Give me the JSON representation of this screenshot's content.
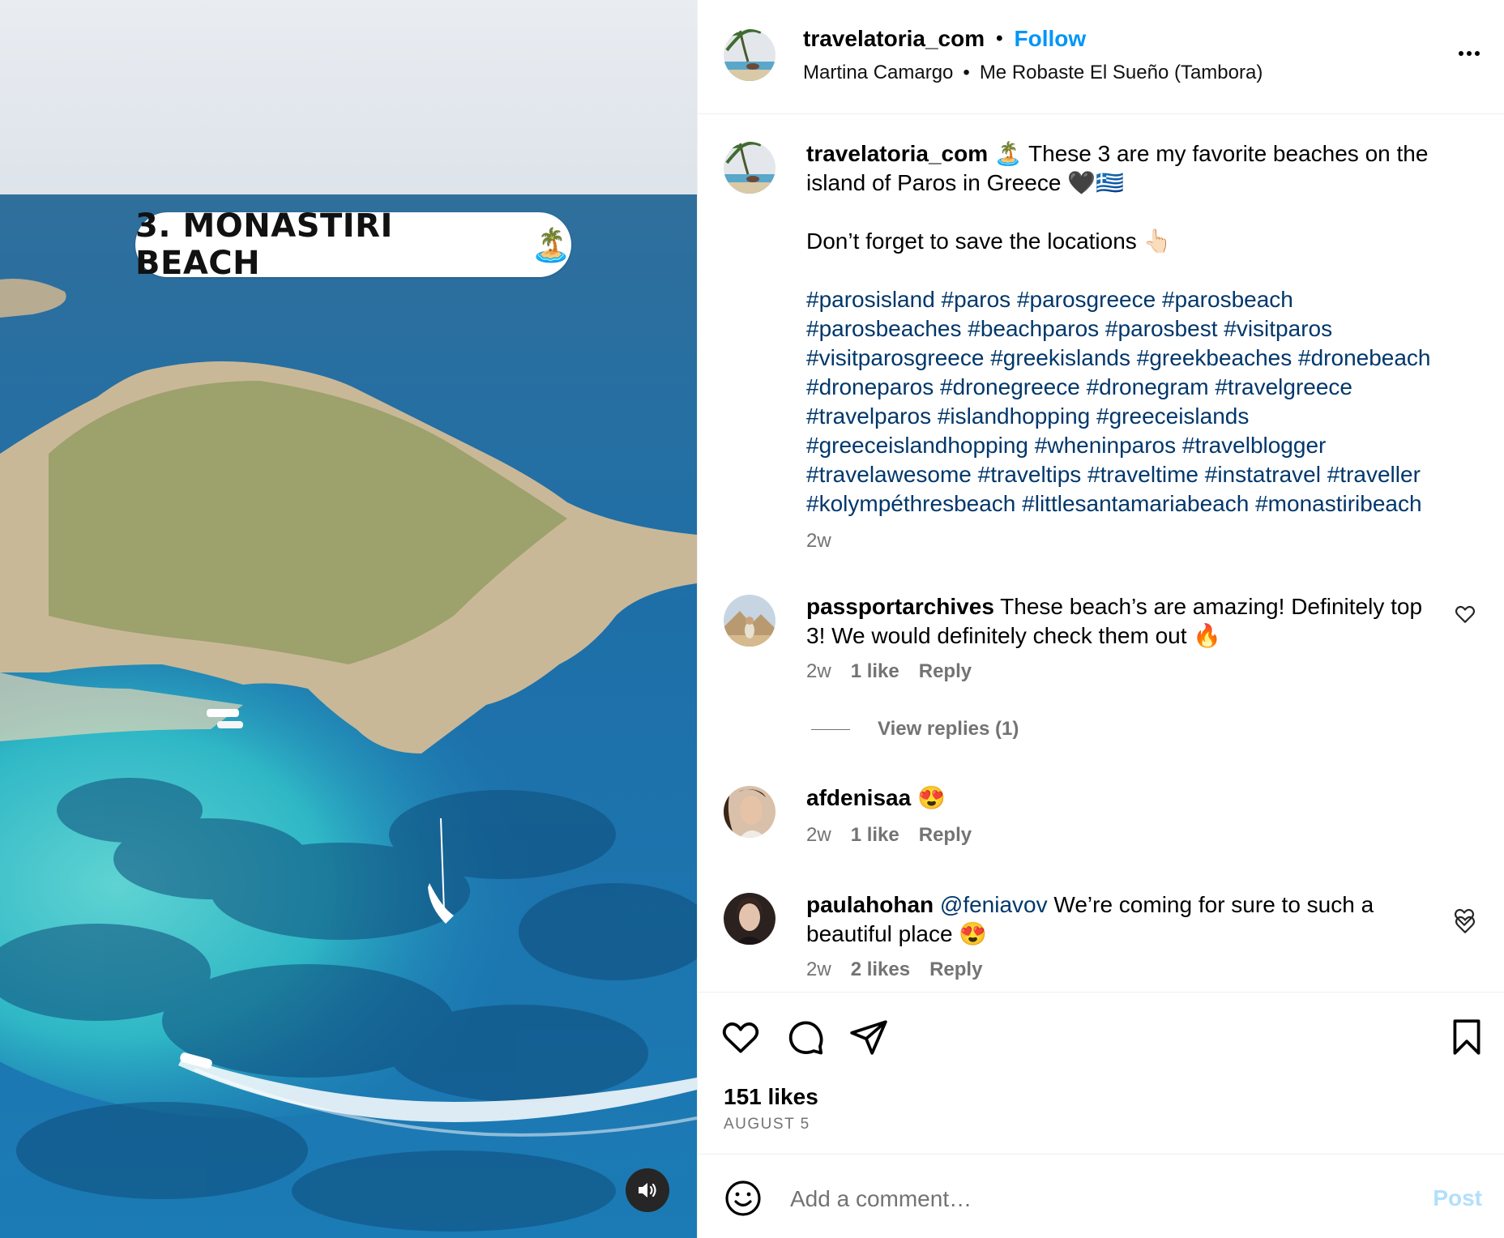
{
  "media": {
    "overlay_text": "3. MONASTIRI BEACH",
    "overlay_emoji": "🏝️",
    "sound_icon": "speaker-icon"
  },
  "header": {
    "username": "travelatoria_com",
    "dot": "•",
    "follow_label": "Follow",
    "audio_artist": "Martina Camargo",
    "audio_sep": "•",
    "audio_track": "Me Robaste El Sueño (Tambora)"
  },
  "caption": {
    "username": "travelatoria_com",
    "text_line1": " 🏝️ These 3 are my favorite beaches on the island of Paros in Greece 🖤🇬🇷",
    "text_line2": "Don’t forget to save the locations 👆🏻",
    "hashtags": "#parosisland #paros #parosgreece #parosbeach #parosbeaches #beachparos #parosbest #visitparos #visitparosgreece #greekislands #greekbeaches #dronebeach #droneparos #dronegreece #dronegram #travelgreece #travelparos #islandhopping #greeceislands #greeceislandhopping #wheninparos #travelblogger #travelawesome #traveltips #traveltime #instatravel #traveller #kolympéthresbeach #littlesantamariabeach #monastiribeach",
    "time": "2w"
  },
  "comments": [
    {
      "username": "passportarchives",
      "text": " These beach’s are amazing! Definitely top 3! We would definitely check them out 🔥",
      "time": "2w",
      "likes": "1 like",
      "reply": "Reply",
      "view_replies": "View replies (1)"
    },
    {
      "username": "afdenisaa",
      "text": " 😍",
      "time": "2w",
      "likes": "1 like",
      "reply": "Reply"
    },
    {
      "username": "paulahohan",
      "mention": " @feniavov",
      "text": " We’re coming for sure to such a beautiful place 😍",
      "time": "2w",
      "likes": "2 likes",
      "reply": "Reply"
    }
  ],
  "actions": {
    "likes": "151 likes",
    "date": "AUGUST 5"
  },
  "add_comment": {
    "placeholder": "Add a comment…",
    "post_label": "Post"
  },
  "colors": {
    "link_blue": "#0095f6",
    "hashtag": "#00376b",
    "muted": "#737373"
  }
}
